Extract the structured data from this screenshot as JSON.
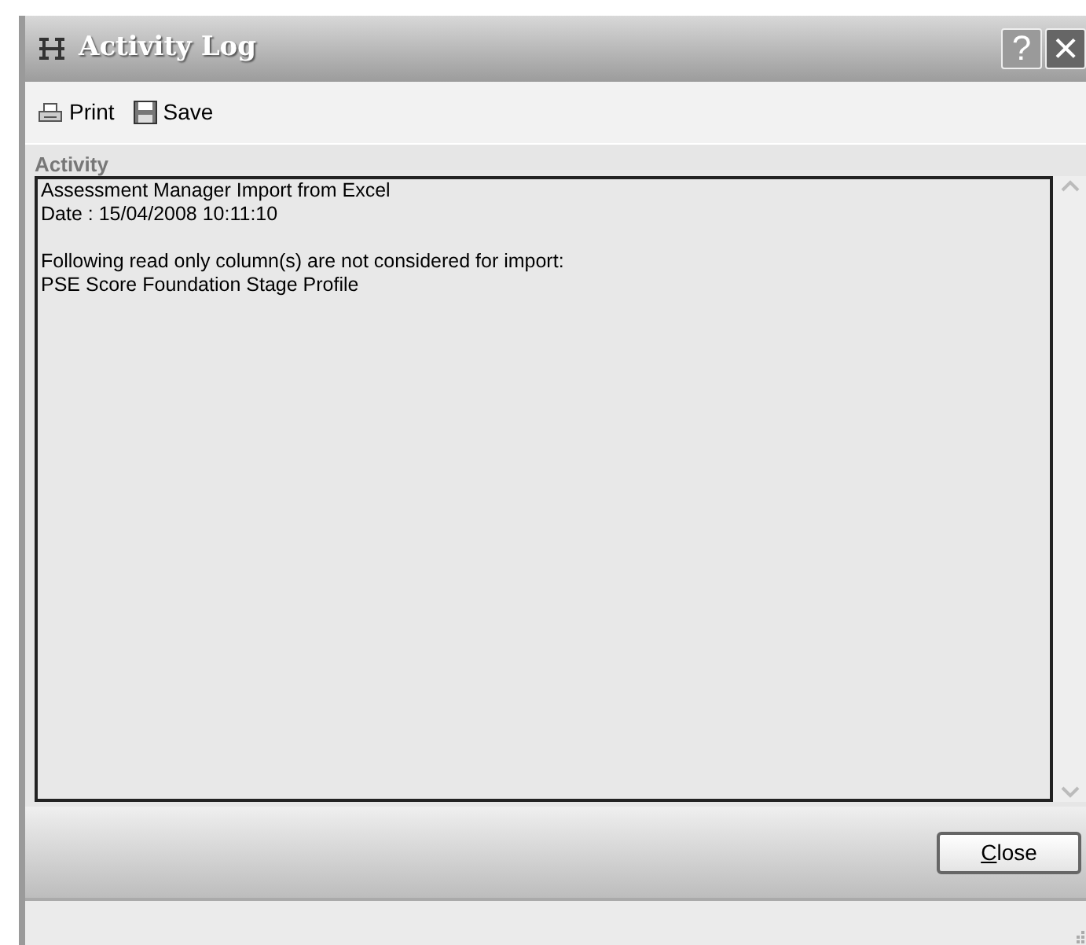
{
  "window": {
    "title": "Activity Log",
    "buttons": [
      {
        "kind": "help",
        "label": "?"
      },
      {
        "kind": "close",
        "label": "×"
      }
    ]
  },
  "toolbar": [
    {
      "kind": "print",
      "label": "Print"
    },
    {
      "kind": "save",
      "label": "Save"
    }
  ],
  "activity": {
    "label": "Activity",
    "paragraphs": [
      {
        "lines": [
          "Assessment Manager Import from Excel",
          "Date : 15/04/2008 10:11:10"
        ]
      },
      {
        "lines": [
          "Following read only column(s) are not considered for import:",
          "PSE Score Foundation Stage Profile"
        ]
      }
    ]
  },
  "footer": {
    "button": {
      "label": "Close",
      "first_letter_underlined": true
    }
  }
}
